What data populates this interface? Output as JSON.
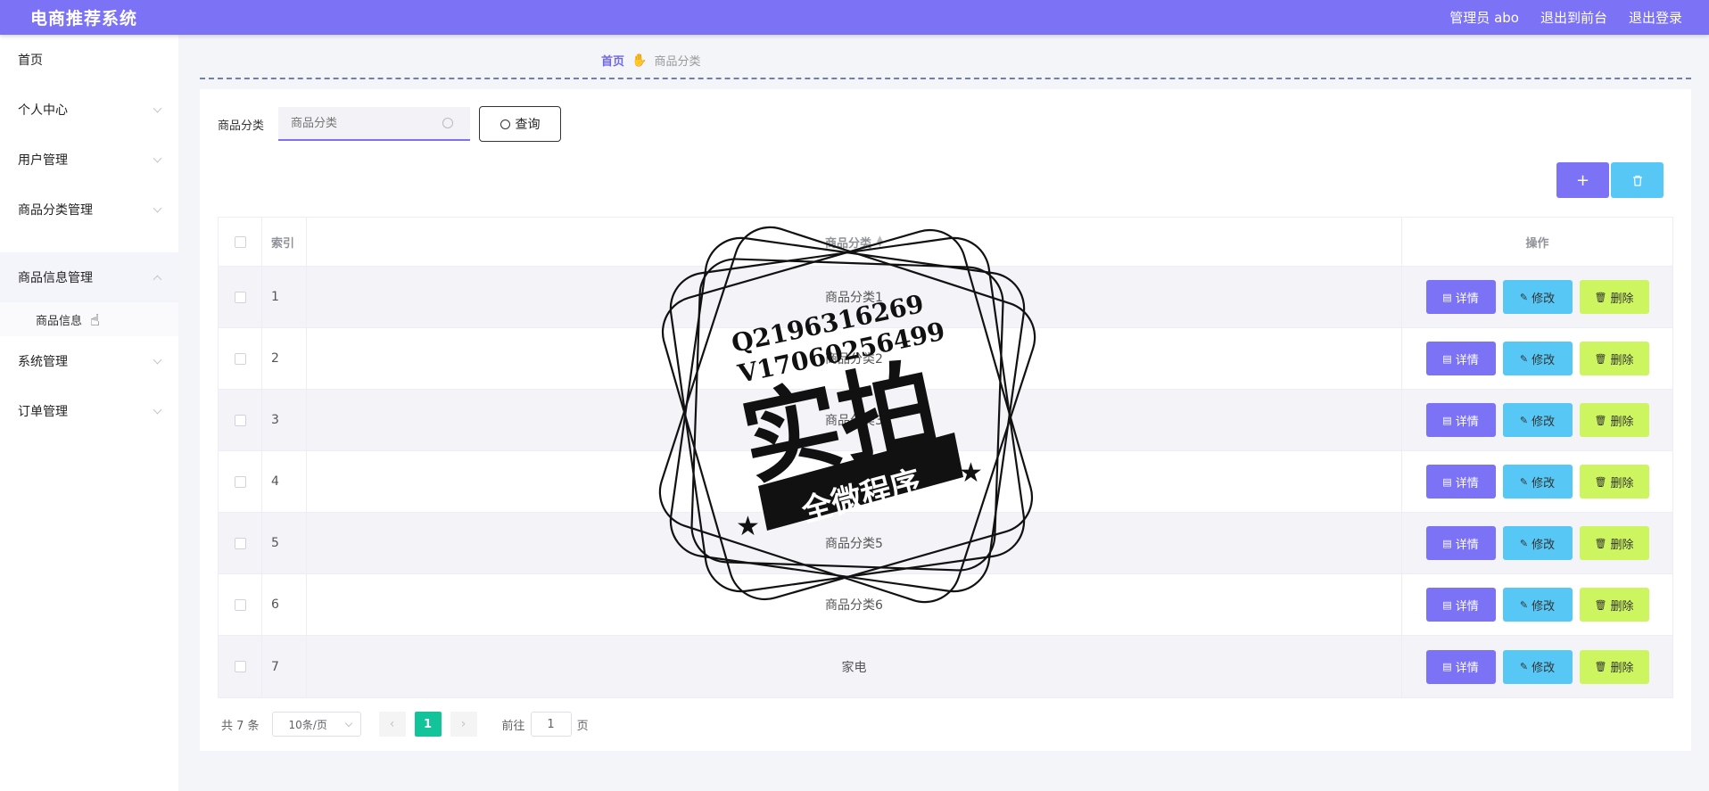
{
  "header": {
    "title": "电商推荐系统",
    "admin": "管理员 abo",
    "to_front": "退出到前台",
    "logout": "退出登录"
  },
  "sidebar": {
    "items": [
      {
        "label": "首页"
      },
      {
        "label": "个人中心"
      },
      {
        "label": "用户管理"
      },
      {
        "label": "商品分类管理"
      },
      {
        "label": "商品信息管理"
      },
      {
        "label": "系统管理"
      },
      {
        "label": "订单管理"
      }
    ],
    "submenu": {
      "label": "商品信息"
    }
  },
  "breadcrumb": {
    "home": "首页",
    "current": "商品分类"
  },
  "search": {
    "label": "商品分类",
    "placeholder": "商品分类",
    "button": "查询"
  },
  "table": {
    "headers": {
      "index": "索引",
      "name": "商品分类",
      "actions": "操作"
    },
    "rows": [
      {
        "index": "1",
        "name": "商品分类1"
      },
      {
        "index": "2",
        "name": "商品分类2"
      },
      {
        "index": "3",
        "name": "商品分类3"
      },
      {
        "index": "4",
        "name": "商品分类4"
      },
      {
        "index": "5",
        "name": "商品分类5"
      },
      {
        "index": "6",
        "name": "商品分类6"
      },
      {
        "index": "7",
        "name": "家电"
      }
    ],
    "actions": {
      "detail": "详情",
      "edit": "修改",
      "remove": "删除"
    }
  },
  "pagination": {
    "total": "共 7 条",
    "page_size": "10条/页",
    "current_page": "1",
    "goto_prefix": "前往",
    "goto_value": "1",
    "goto_suffix": "页"
  },
  "watermark": {
    "line1": "Q2196316269",
    "line2": "V17060256499",
    "main": "实拍",
    "banner": "全微程序"
  },
  "colors": {
    "primary": "#7b72f5",
    "info": "#57c7f5",
    "warning": "#cdf55f",
    "active_page": "#13c49b"
  }
}
